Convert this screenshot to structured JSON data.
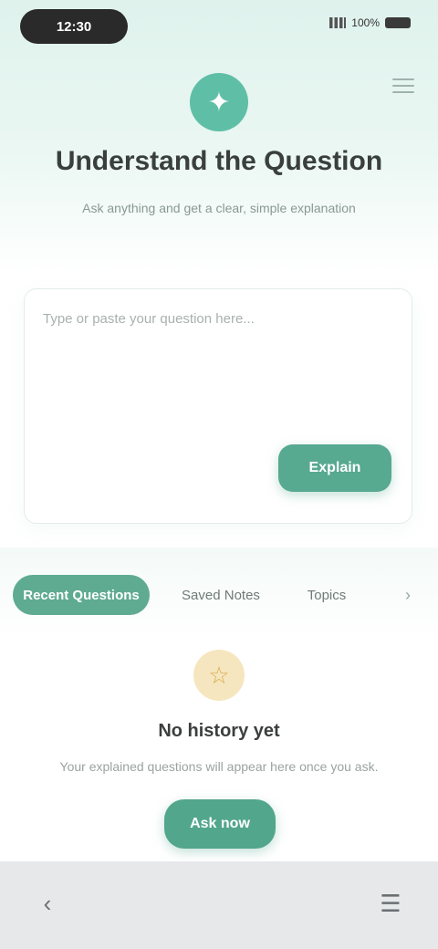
{
  "status_bar": {
    "time": "12:30",
    "battery": "100%"
  },
  "header": {
    "logo_glyph": "✦",
    "title": "Understand the Question",
    "subtitle": "Ask anything and get a clear, simple explanation"
  },
  "question_card": {
    "placeholder": "Type or paste your question here...",
    "submit_label": "Explain"
  },
  "tabs": [
    {
      "label": "Recent Questions",
      "active": true
    },
    {
      "label": "Saved Notes",
      "active": false
    },
    {
      "label": "Topics",
      "active": false
    }
  ],
  "tabs_more_glyph": "›",
  "empty_state": {
    "icon_glyph": "☆",
    "title": "No history yet",
    "message": "Your explained questions will appear here once you ask.",
    "button_label": "Ask now"
  },
  "bottom_nav": {
    "back_glyph": "‹",
    "menu_glyph": "☰"
  },
  "colors": {
    "accent": "#57a98f",
    "hero_background": "#dff2ec",
    "empty_icon_background": "#f6e6bf",
    "bottom_bar": "#e6e8ea"
  }
}
